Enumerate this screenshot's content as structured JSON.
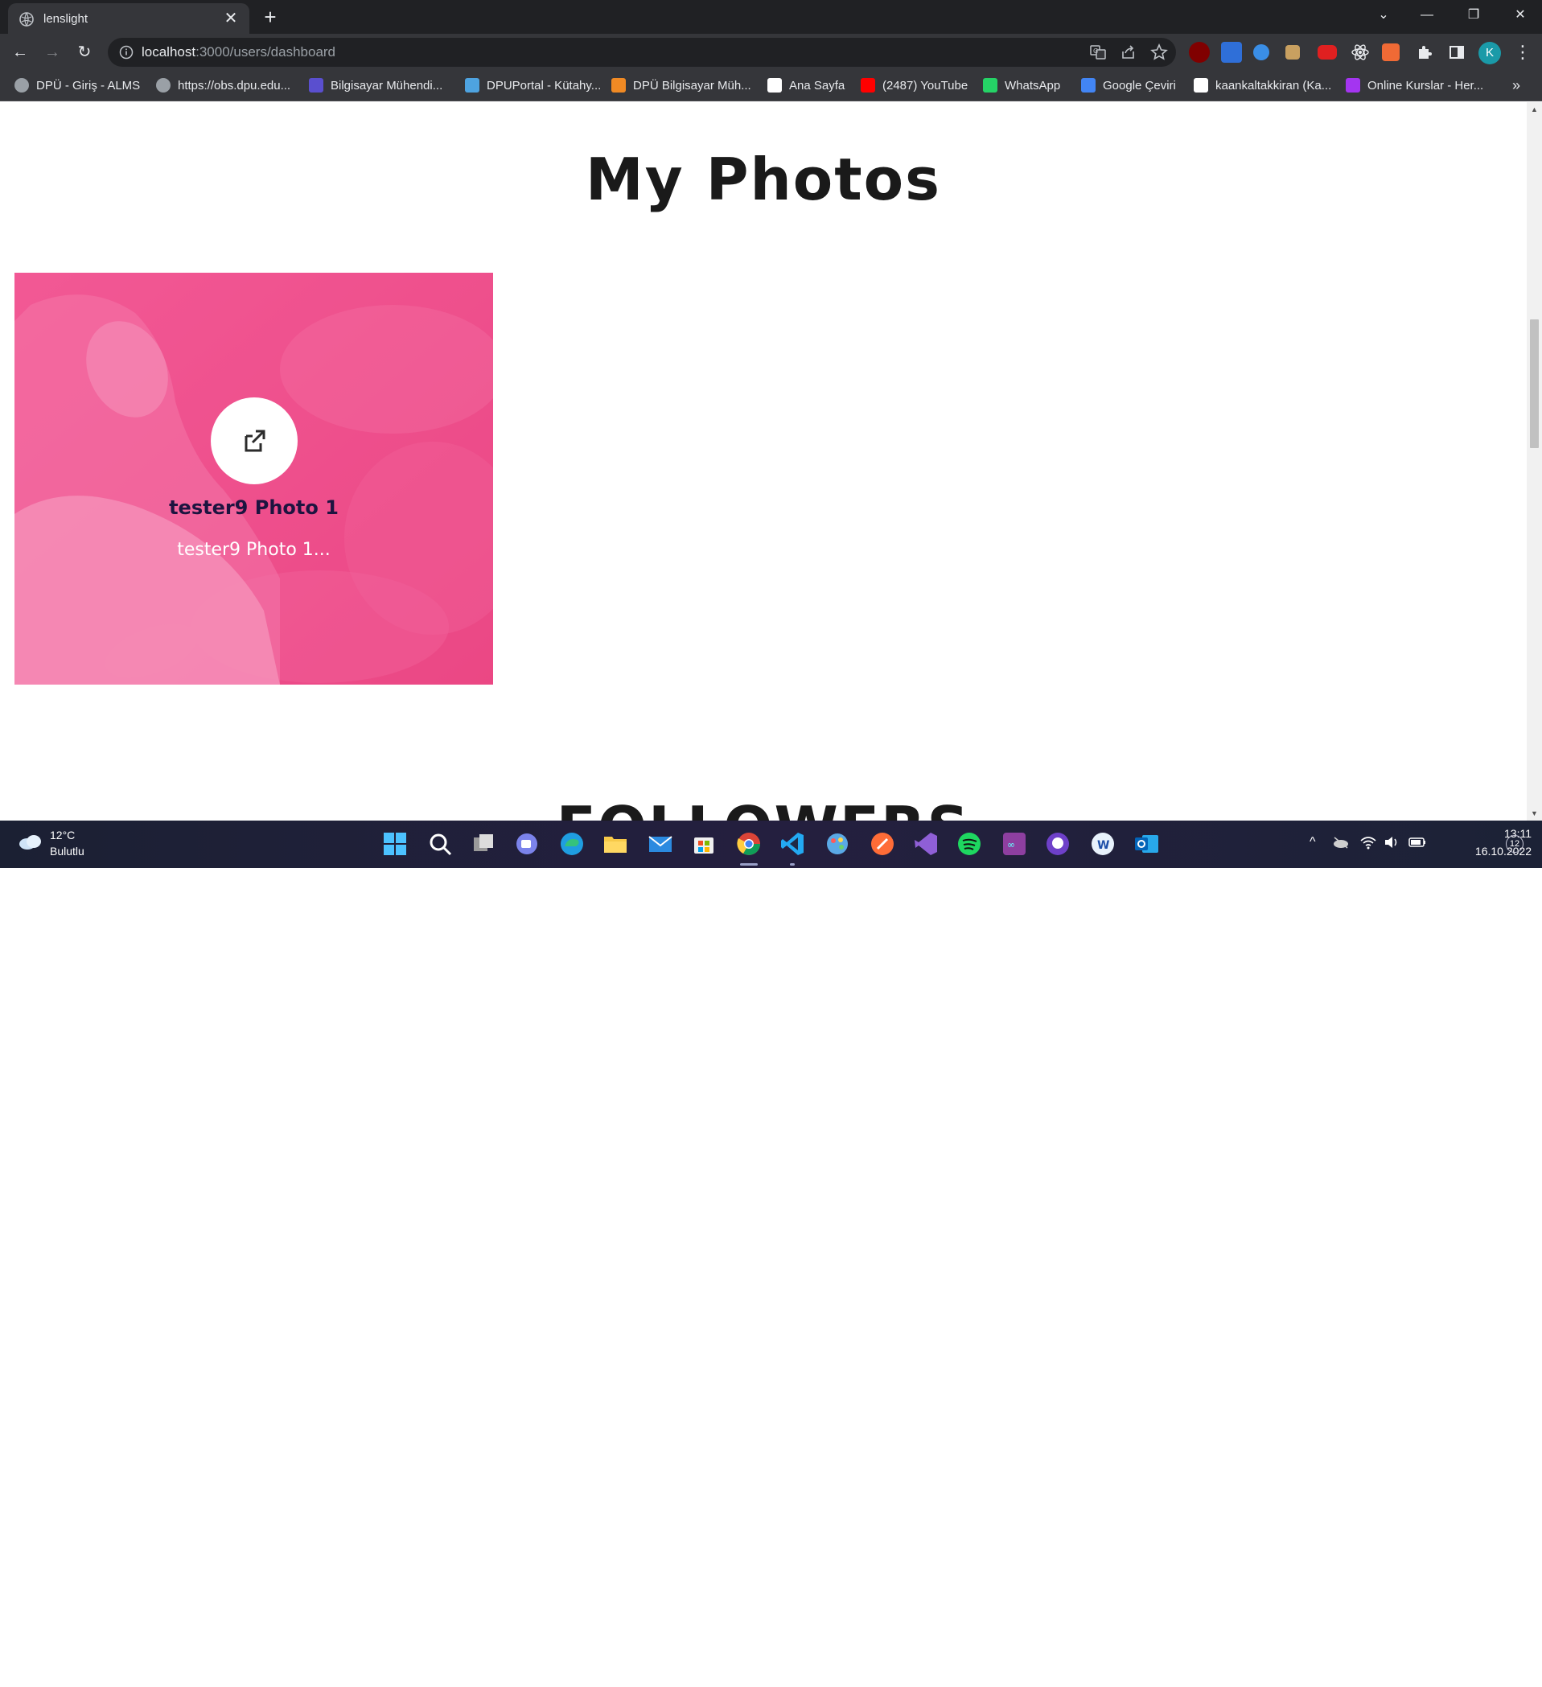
{
  "browser": {
    "tab_title": "lenslight",
    "tab_close": "✕",
    "new_tab": "+",
    "url_host": "localhost",
    "url_rest": ":3000/users/dashboard",
    "profile_initial": "K",
    "more_bookmarks": "»"
  },
  "bookmarks": [
    {
      "label": "DPÜ - Giriş - ALMS",
      "icon": "globe-icon",
      "color": "#9aa0a6"
    },
    {
      "label": "https://obs.dpu.edu...",
      "icon": "globe-icon",
      "color": "#9aa0a6"
    },
    {
      "label": "Bilgisayar Mühendi...",
      "icon": "dpu-logo-icon",
      "color": "#5a4fcf"
    },
    {
      "label": "DPUPortal - Kütahy...",
      "icon": "question-icon",
      "color": "#4ea3e0"
    },
    {
      "label": "DPÜ Bilgisayar Müh...",
      "icon": "dpu-orange-icon",
      "color": "#f08a24"
    },
    {
      "label": "Ana Sayfa",
      "icon": "btk-icon",
      "color": "#ffffff"
    },
    {
      "label": "(2487) YouTube",
      "icon": "youtube-icon",
      "color": "#ff0000"
    },
    {
      "label": "WhatsApp",
      "icon": "whatsapp-icon",
      "color": "#25d366"
    },
    {
      "label": "Google Çeviri",
      "icon": "google-translate-icon",
      "color": "#4285f4"
    },
    {
      "label": "kaankaltakkiran (Ka...",
      "icon": "github-icon",
      "color": "#ffffff"
    },
    {
      "label": "Online Kurslar - Her...",
      "icon": "udemy-icon",
      "color": "#a435f0"
    }
  ],
  "page": {
    "title": "My Photos",
    "followers_title": "FOLLOWERS"
  },
  "photos": [
    {
      "name": "tester9 Photo 1",
      "description": "tester9 Photo 1...",
      "overlay_color": "#f0508f"
    }
  ],
  "taskbar": {
    "weather_temp": "12°C",
    "weather_condition": "Bulutlu",
    "time": "13:11",
    "date": "16.10.2022",
    "notifications": "12"
  }
}
